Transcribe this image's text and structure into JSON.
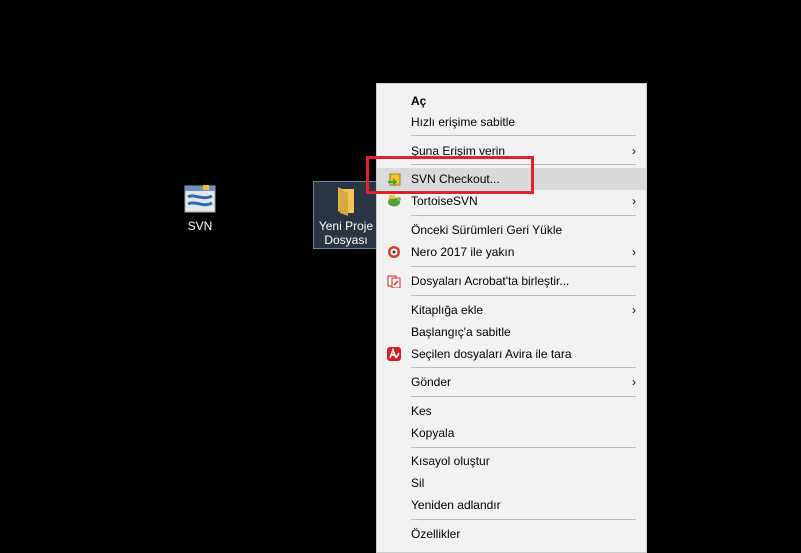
{
  "desktop": {
    "svn_label": "SVN",
    "folder_label_line1": "Yeni Proje",
    "folder_label_line2": "Dosyası"
  },
  "menu": {
    "open": "Aç",
    "pin_quick": "Hızlı erişime sabitle",
    "give_access": "Şuna Erişim verin",
    "svn_checkout": "SVN Checkout...",
    "tortoise": "TortoiseSVN",
    "restore_prev": "Önceki Sürümleri Geri Yükle",
    "nero": "Nero 2017 ile yakın",
    "acrobat": "Dosyaları Acrobat'ta birleştir...",
    "library": "Kitaplığa ekle",
    "pin_start": "Başlangıç'a sabitle",
    "avira": "Seçilen dosyaları Avira ile tara",
    "send_to": "Gönder",
    "cut": "Kes",
    "copy": "Kopyala",
    "shortcut": "Kısayol oluştur",
    "delete": "Sil",
    "rename": "Yeniden adlandır",
    "properties": "Özellikler",
    "arrow": "›"
  },
  "colors": {
    "menu_bg": "#f2f2f2",
    "highlight": "#dadada",
    "annotation": "#e2202e",
    "folder": "#f2c55c"
  },
  "icons": [
    "svn-shortcut-icon",
    "folder-icon",
    "svn-checkout-icon",
    "tortoisesvn-icon",
    "nero-icon",
    "acrobat-icon",
    "avira-icon",
    "chevron-right-icon"
  ]
}
